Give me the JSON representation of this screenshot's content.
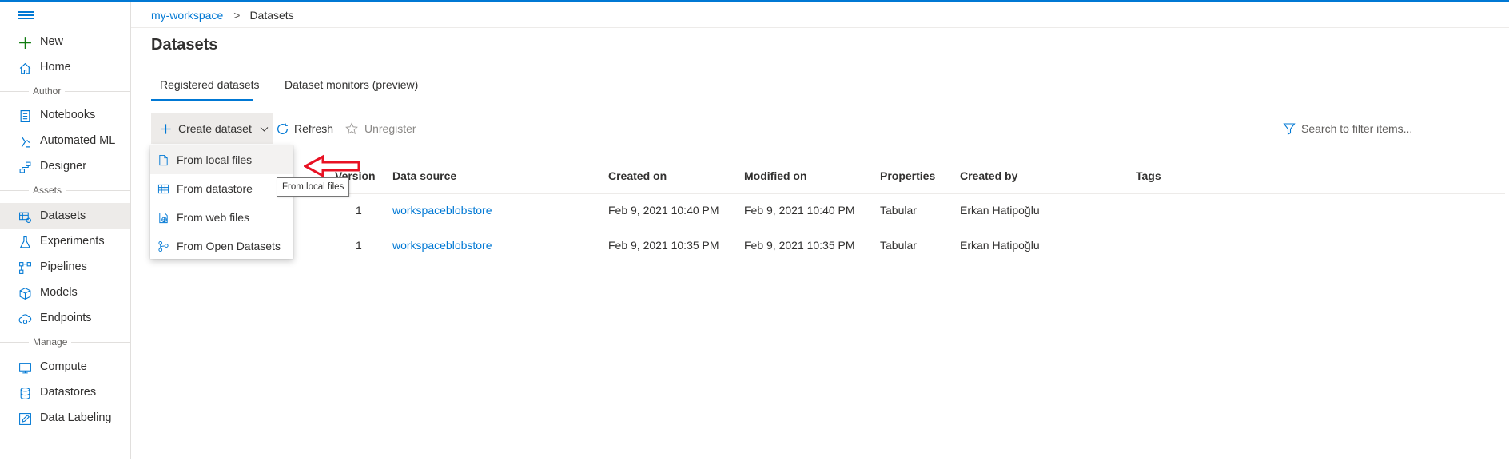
{
  "sidebar": {
    "new_label": "New",
    "home_label": "Home",
    "sections": {
      "author": "Author",
      "assets": "Assets",
      "manage": "Manage"
    },
    "items": [
      {
        "label": "Notebooks",
        "icon": "notebook-icon"
      },
      {
        "label": "Automated ML",
        "icon": "automl-icon"
      },
      {
        "label": "Designer",
        "icon": "designer-icon"
      },
      {
        "label": "Datasets",
        "icon": "dataset-icon",
        "active": true
      },
      {
        "label": "Experiments",
        "icon": "flask-icon"
      },
      {
        "label": "Pipelines",
        "icon": "pipeline-icon"
      },
      {
        "label": "Models",
        "icon": "cube-icon"
      },
      {
        "label": "Endpoints",
        "icon": "cloud-endpoint-icon"
      },
      {
        "label": "Compute",
        "icon": "monitor-icon"
      },
      {
        "label": "Datastores",
        "icon": "database-icon"
      },
      {
        "label": "Data Labeling",
        "icon": "edit-tag-icon"
      }
    ]
  },
  "breadcrumb": {
    "workspace": "my-workspace",
    "separator": ">",
    "current": "Datasets"
  },
  "page": {
    "title": "Datasets"
  },
  "tabs": [
    {
      "label": "Registered datasets",
      "active": true
    },
    {
      "label": "Dataset monitors (preview)",
      "active": false
    }
  ],
  "toolbar": {
    "create_label": "Create dataset",
    "refresh_label": "Refresh",
    "unregister_label": "Unregister",
    "search_placeholder": "Search to filter items..."
  },
  "table": {
    "columns": {
      "version": "Version",
      "data_source": "Data source",
      "created_on": "Created on",
      "modified_on": "Modified on",
      "properties": "Properties",
      "created_by": "Created by",
      "tags": "Tags"
    },
    "rows": [
      {
        "version": "1",
        "data_source": "workspaceblobstore",
        "created_on": "Feb 9, 2021 10:40 PM",
        "modified_on": "Feb 9, 2021 10:40 PM",
        "properties": "Tabular",
        "created_by": "Erkan Hatipoğlu"
      },
      {
        "version": "1",
        "data_source": "workspaceblobstore",
        "created_on": "Feb 9, 2021 10:35 PM",
        "modified_on": "Feb 9, 2021 10:35 PM",
        "properties": "Tabular",
        "created_by": "Erkan Hatipoğlu"
      }
    ]
  },
  "dropdown": {
    "items": [
      {
        "label": "From local files",
        "icon": "file-icon"
      },
      {
        "label": "From datastore",
        "icon": "table-grid-icon"
      },
      {
        "label": "From web files",
        "icon": "web-file-icon"
      },
      {
        "label": "From Open Datasets",
        "icon": "open-datasets-icon"
      }
    ]
  },
  "tooltip": {
    "text": "From local files"
  },
  "colors": {
    "accent": "#0078d4",
    "annotation_arrow": "#e81123"
  }
}
